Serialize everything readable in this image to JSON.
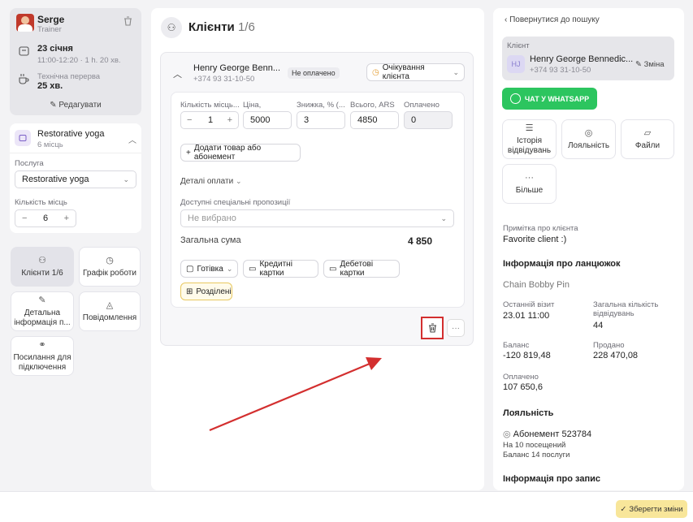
{
  "trainer": {
    "name": "Serge",
    "role": "Trainer",
    "date": "23 січня",
    "time": "11:00-12:20 · 1 h. 20 хв.",
    "break_label": "Технічна перерва",
    "break_value": "25 хв.",
    "edit_label": "Редагувати"
  },
  "session": {
    "title": "Restorative yoga",
    "places": "6 місць",
    "service_label": "Послуга",
    "service_value": "Restorative yoga",
    "places_label": "Кількість місць",
    "places_count": "6"
  },
  "nav": {
    "clients": "Клієнти 1/6",
    "schedule": "Графік роботи",
    "details": "Детальна інформація п...",
    "notifications": "Повідомлення",
    "link": "Посилання для підключення"
  },
  "main": {
    "title": "Клієнти",
    "count": "1/6",
    "client_name": "Henry George Benn...",
    "client_phone": "+374 93 31-10-50",
    "payment_status": "Не оплачено",
    "waiting_status": "Очікування клієнта",
    "col_qty": "Кількість місць...",
    "col_price": "Ціна,",
    "col_discount": "Знижка, % (...",
    "col_total": "Всього, ARS",
    "col_paid": "Оплачено",
    "qty_value": "1",
    "price_value": "5000",
    "discount_value": "3",
    "total_value": "4850",
    "paid_value": "0",
    "add_item": "Додати товар або абонемент",
    "payment_details": "Деталі оплати",
    "offers_label": "Доступні спеціальні пропозиції",
    "offers_placeholder": "Не вибрано",
    "sum_label": "Загальна сума",
    "sum_value": "4 850",
    "pay_cash": "Готівка",
    "pay_credit": "Кредитні картки",
    "pay_debit": "Дебетові картки",
    "pay_split": "Розділені"
  },
  "right": {
    "back": "Повернутися до пошуку",
    "client_label": "Клієнт",
    "initials": "HJ",
    "client_name": "Henry George Bennedic...",
    "client_phone": "+374 93 31-10-50",
    "change": "Зміна",
    "whatsapp": "ЧАТ У WHATSAPP",
    "history": "Історія відвідувань",
    "loyalty": "Лояльність",
    "files": "Файли",
    "more": "Більше",
    "note_label": "Примітка про клієнта",
    "note_value": "Favorite client :)",
    "chain_heading": "Інформація про ланцюжок",
    "chain_name": "Chain Bobby Pin",
    "last_visit_label": "Останній візит",
    "last_visit_value": "23.01 11:00",
    "visits_label": "Загальна кількість відвідувань",
    "visits_value": "44",
    "balance_label": "Баланс",
    "balance_value": "-120 819,48",
    "sold_label": "Продано",
    "sold_value": "228 470,08",
    "paid_label": "Оплачено",
    "paid_value": "107 650,6",
    "loyalty_heading": "Лояльність",
    "subscription": "Абонемент 523784",
    "subscription_desc": "На 10 посещений",
    "subscription_balance": "Баланс 14 послуги",
    "record_heading": "Інформація про запис"
  },
  "footer": {
    "save": "Зберегти зміни"
  }
}
